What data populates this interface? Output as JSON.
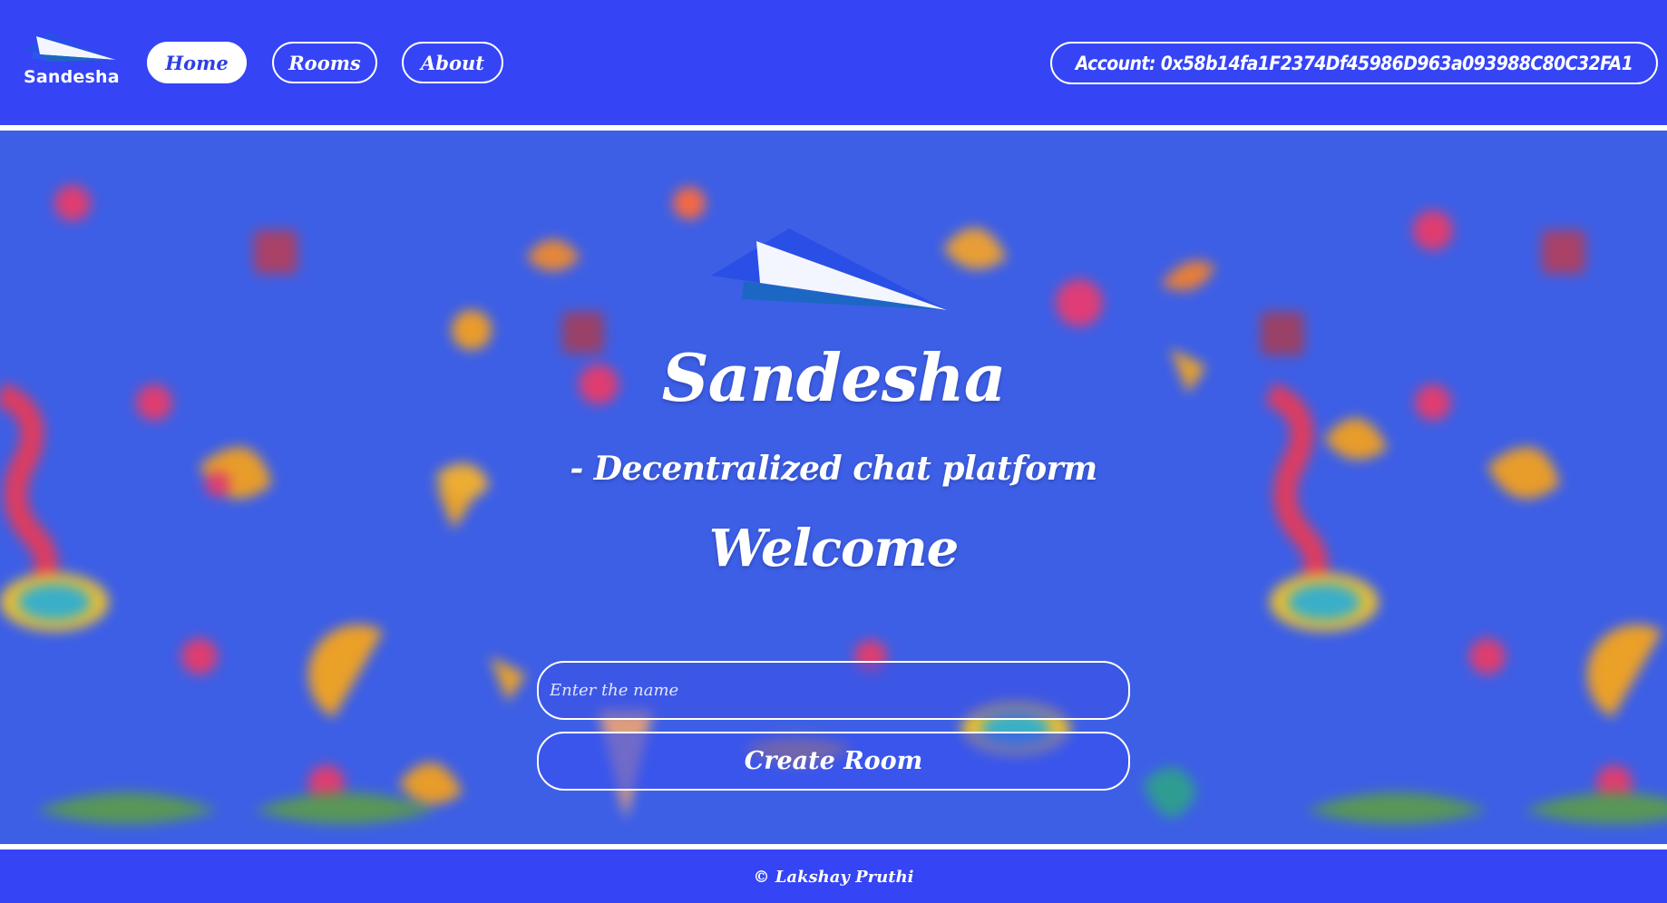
{
  "app": {
    "brand_name": "Sandesha"
  },
  "nav": {
    "items": [
      {
        "label": "Home",
        "active": true
      },
      {
        "label": "Rooms",
        "active": false
      },
      {
        "label": "About",
        "active": false
      }
    ]
  },
  "account": {
    "label": "Account: 0x58b14fa1F2374Df45986D963a093988C80C32FA1"
  },
  "hero": {
    "title": "Sandesha",
    "subtitle": "- Decentralized chat platform",
    "welcome": "Welcome",
    "name_input": {
      "placeholder": "Enter the name",
      "value": ""
    },
    "create_button_label": "Create Room"
  },
  "footer": {
    "text": "© Lakshay Pruthi"
  },
  "icons": {
    "logo": "paper-plane-icon"
  },
  "colors": {
    "header_bg": "#3544f5",
    "hero_bg": "#3d5fe6",
    "accent_white": "#ffffff",
    "active_nav_text": "#2f3fe6"
  }
}
